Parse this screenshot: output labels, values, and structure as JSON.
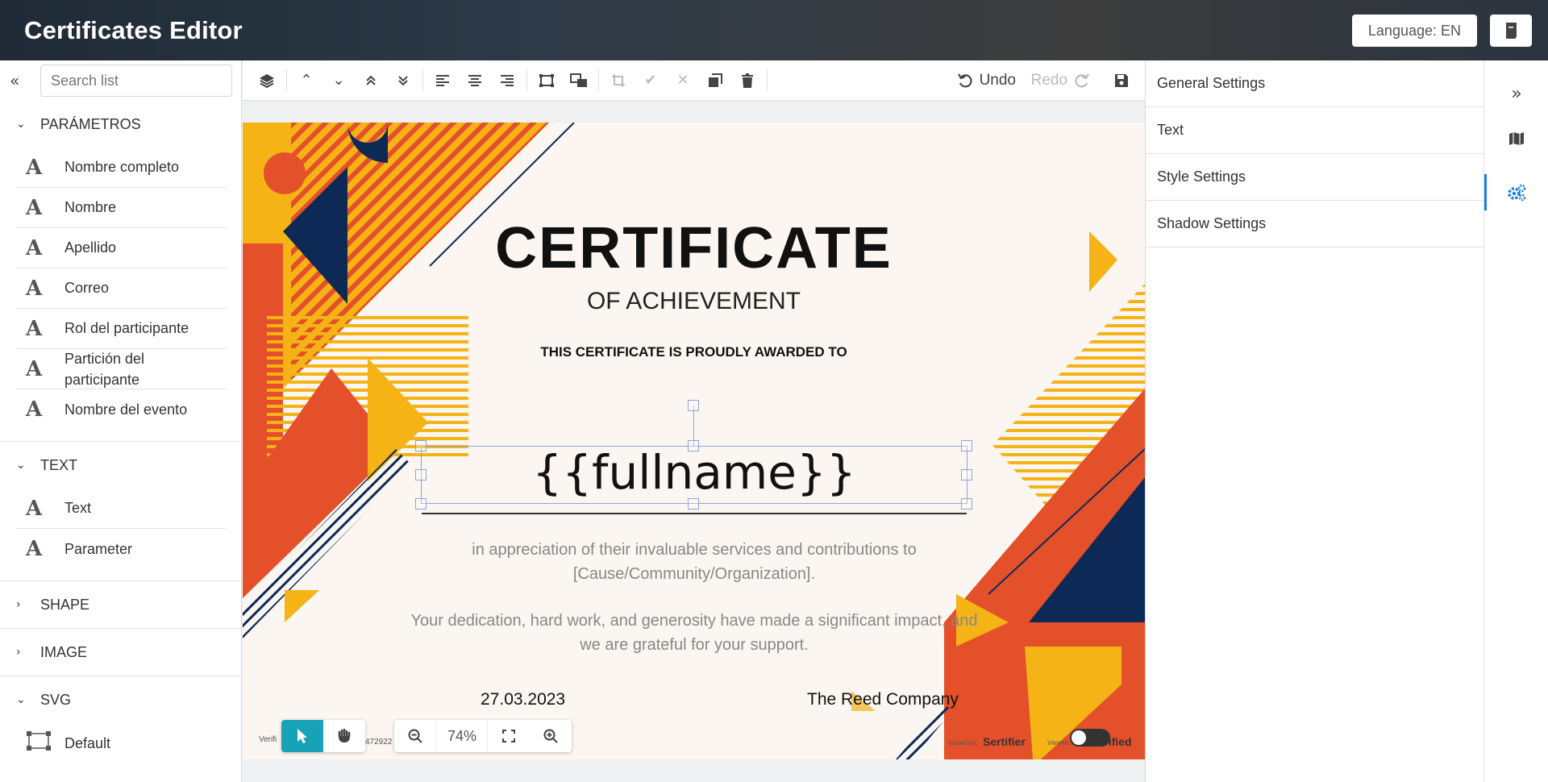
{
  "header": {
    "title": "Certificates Editor",
    "language_label": "Language: EN"
  },
  "left_panel": {
    "search_placeholder": "Search list",
    "sections": {
      "parametros": {
        "title": "PARÁMETROS",
        "items": [
          "Nombre completo",
          "Nombre",
          "Apellido",
          "Correo",
          "Rol del participante",
          "Partición del participante",
          "Nombre del evento"
        ]
      },
      "text": {
        "title": "TEXT",
        "items": [
          "Text",
          "Parameter"
        ]
      },
      "shape": {
        "title": "SHAPE"
      },
      "image": {
        "title": "IMAGE"
      },
      "svg": {
        "title": "SVG",
        "items": [
          "Default"
        ]
      }
    }
  },
  "toolbar": {
    "undo_label": "Undo",
    "redo_label": "Redo"
  },
  "certificate": {
    "title": "CERTIFICATE",
    "subtitle": "OF ACHIEVEMENT",
    "awarded_to": "THIS CERTIFICATE IS PROUDLY AWARDED TO",
    "fullname_placeholder": "{{fullname}}",
    "appreciation": "in appreciation of their invaluable services and contributions to [Cause/Community/Organization].",
    "dedication": "Your dedication, hard work, and generosity have made a significant impact, and we are grateful for your support.",
    "date": "27.03.2023",
    "company": "The Reed Company",
    "footer_left": "Verifi",
    "footer_id": "472922",
    "issued_by": "Issued by:",
    "issuer_brand": "Sertifier",
    "viewed_by": "Viewed by:",
    "verified_brand": "Verified"
  },
  "zoom": {
    "value": "74%"
  },
  "right_panel": {
    "items": [
      "General Settings",
      "Text",
      "Style Settings",
      "Shadow Settings"
    ]
  },
  "colors": {
    "accent": "#17a2b8",
    "rail_active": "#1e7ddb",
    "orange": "#e4502a",
    "yellow": "#f5b316",
    "navy": "#0d2a57"
  }
}
